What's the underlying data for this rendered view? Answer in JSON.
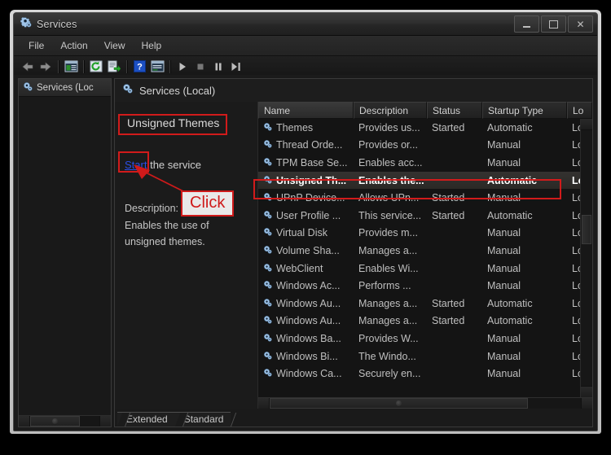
{
  "window": {
    "title": "Services",
    "icon": "services-gear-icon",
    "caption_buttons": [
      {
        "name": "minimize-button",
        "glyph": "minimize"
      },
      {
        "name": "maximize-button",
        "glyph": "maximize"
      },
      {
        "name": "close-button",
        "glyph": "close"
      }
    ]
  },
  "menubar": {
    "items": [
      "File",
      "Action",
      "View",
      "Help"
    ]
  },
  "toolbar": {
    "buttons": [
      {
        "name": "back-icon",
        "glyph": "back-arrow"
      },
      {
        "name": "forward-icon",
        "glyph": "forward-arrow"
      },
      {
        "name": "show-hide-tree-icon",
        "glyph": "tree-panel"
      },
      {
        "name": "refresh-icon",
        "glyph": "refresh"
      },
      {
        "name": "export-list-icon",
        "glyph": "export"
      },
      {
        "name": "help-icon",
        "glyph": "question"
      },
      {
        "name": "properties-icon",
        "glyph": "properties"
      },
      {
        "name": "start-service-icon",
        "glyph": "play"
      },
      {
        "name": "stop-service-icon",
        "glyph": "stop"
      },
      {
        "name": "pause-service-icon",
        "glyph": "pause"
      },
      {
        "name": "restart-service-icon",
        "glyph": "restart"
      }
    ]
  },
  "tree": {
    "root_label": "Services (Loc"
  },
  "right_pane": {
    "header": "Services (Local)",
    "service_title": "Unsigned Themes",
    "start_link": "Start",
    "start_suffix": " the service",
    "description_label": "Description:",
    "description_line1": "Enables the use of",
    "description_line2": "unsigned themes."
  },
  "list": {
    "columns": [
      "Name",
      "Description",
      "Status",
      "Startup Type",
      "Lo"
    ],
    "rows": [
      {
        "name": "Themes",
        "description": "Provides us...",
        "status": "Started",
        "startup": "Automatic",
        "logon": "Lo",
        "selected": false
      },
      {
        "name": "Thread Orde...",
        "description": "Provides or...",
        "status": "",
        "startup": "Manual",
        "logon": "Lo",
        "selected": false
      },
      {
        "name": "TPM Base Se...",
        "description": "Enables acc...",
        "status": "",
        "startup": "Manual",
        "logon": "Lo",
        "selected": false
      },
      {
        "name": "Unsigned Th...",
        "description": "Enables the...",
        "status": "",
        "startup": "Automatic",
        "logon": "Lo",
        "selected": true
      },
      {
        "name": "UPnP Device...",
        "description": "Allows UPn...",
        "status": "Started",
        "startup": "Manual",
        "logon": "Lo",
        "selected": false
      },
      {
        "name": "User Profile ...",
        "description": "This service...",
        "status": "Started",
        "startup": "Automatic",
        "logon": "Lo",
        "selected": false
      },
      {
        "name": "Virtual Disk",
        "description": "Provides m...",
        "status": "",
        "startup": "Manual",
        "logon": "Lo",
        "selected": false
      },
      {
        "name": "Volume Sha...",
        "description": "Manages a...",
        "status": "",
        "startup": "Manual",
        "logon": "Lo",
        "selected": false
      },
      {
        "name": "WebClient",
        "description": "Enables Wi...",
        "status": "",
        "startup": "Manual",
        "logon": "Lo",
        "selected": false
      },
      {
        "name": "Windows Ac...",
        "description": "Performs ...",
        "status": "",
        "startup": "Manual",
        "logon": "Lo",
        "selected": false
      },
      {
        "name": "Windows Au...",
        "description": "Manages a...",
        "status": "Started",
        "startup": "Automatic",
        "logon": "Lo",
        "selected": false
      },
      {
        "name": "Windows Au...",
        "description": "Manages a...",
        "status": "Started",
        "startup": "Automatic",
        "logon": "Lo",
        "selected": false
      },
      {
        "name": "Windows Ba...",
        "description": "Provides W...",
        "status": "",
        "startup": "Manual",
        "logon": "Lo",
        "selected": false
      },
      {
        "name": "Windows Bi...",
        "description": "The Windo...",
        "status": "",
        "startup": "Manual",
        "logon": "Lo",
        "selected": false
      },
      {
        "name": "Windows Ca...",
        "description": "Securely en...",
        "status": "",
        "startup": "Manual",
        "logon": "Lo",
        "selected": false
      }
    ]
  },
  "tabs": [
    {
      "label": "Extended",
      "active": false
    },
    {
      "label": "Standard",
      "active": true
    }
  ],
  "annotations": {
    "click_badge": "Click",
    "highlight_color": "#cf1a1a"
  },
  "colors": {
    "accent_link": "#2b4fe8",
    "annotation_red": "#cf1a1a",
    "window_bg": "#1b1b1b"
  }
}
